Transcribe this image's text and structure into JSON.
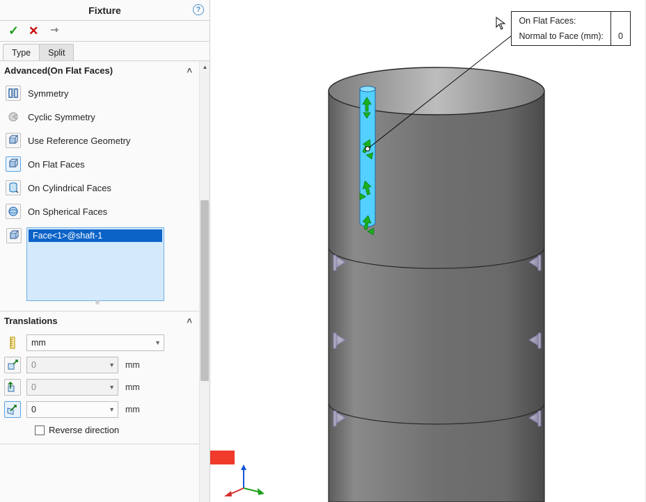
{
  "panel": {
    "title": "Fixture",
    "help_label": "?",
    "tabs": {
      "type": "Type",
      "split": "Split"
    },
    "section1": {
      "header": "Advanced(On Flat Faces)",
      "options": {
        "symmetry": "Symmetry",
        "cyclic": "Cyclic Symmetry",
        "refgeom": "Use Reference Geometry",
        "flat": "On Flat Faces",
        "cyl": "On Cylindrical Faces",
        "sph": "On Spherical Faces"
      },
      "selection_item": "Face<1>@shaft-1"
    },
    "translations": {
      "header": "Translations",
      "unit": "mm",
      "dir1_val": "0",
      "dir1_unit": "mm",
      "dir2_val": "0",
      "dir2_unit": "mm",
      "normal_val": "0",
      "normal_unit": "mm",
      "reverse_label": "Reverse direction"
    }
  },
  "callout": {
    "line1": "On Flat Faces:",
    "line2_label": "Normal to Face (mm):",
    "line2_val": "0"
  }
}
